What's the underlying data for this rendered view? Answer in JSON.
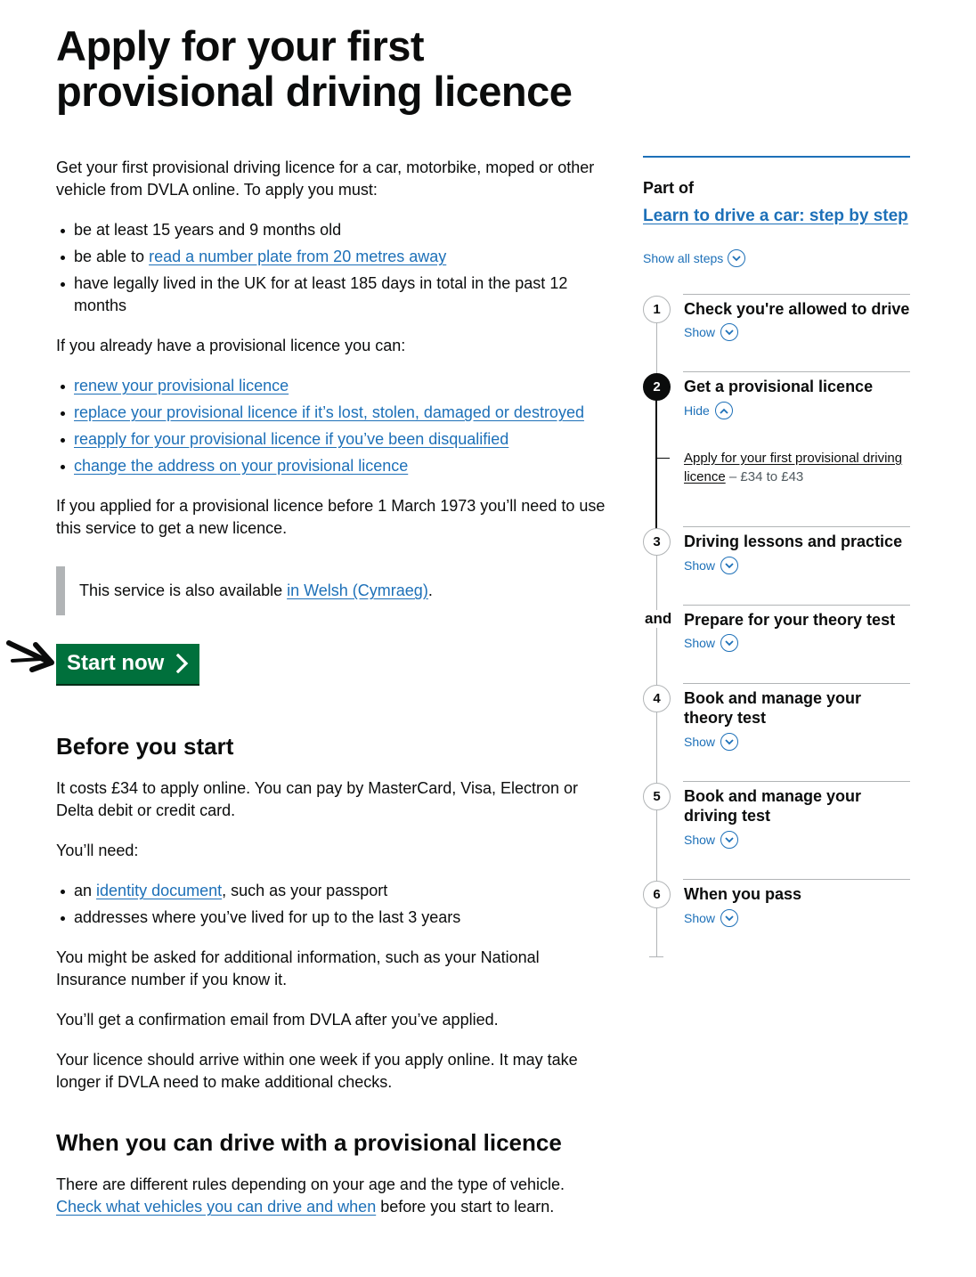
{
  "page": {
    "title": "Apply for your first provisional driving licence"
  },
  "main": {
    "intro": "Get your first provisional driving licence for a car, motorbike, moped or other vehicle from DVLA online. To apply you must:",
    "requirements": {
      "item1": "be at least 15 years and 9 months old",
      "item2_prefix": "be able to ",
      "item2_link": "read a number plate from 20 metres away",
      "item3": "have legally lived in the UK for at least 185 days in total in the past 12 months"
    },
    "already_have": "If you already have a provisional licence you can:",
    "links": [
      "renew your provisional licence",
      "replace your provisional licence if it’s lost, stolen, damaged or destroyed",
      "reapply for your provisional licence if you’ve been disqualified",
      "change the address on your provisional licence"
    ],
    "before_1973": "If you applied for a provisional licence before 1 March 1973 you’ll need to use this service to get a new licence.",
    "welsh": {
      "prefix": "This service is also available ",
      "link": "in Welsh (Cymraeg)",
      "suffix": "."
    },
    "start_button": "Start now",
    "before_you_start": {
      "heading": "Before you start",
      "costs": "It costs £34 to apply online. You can pay by MasterCard, Visa, Electron or Delta debit or credit card.",
      "need": "You’ll need:",
      "need_item1_prefix": "an ",
      "need_item1_link": "identity document",
      "need_item1_suffix": ", such as your passport",
      "need_item2": "addresses where you’ve lived for up to the last 3 years",
      "additional": "You might be asked for additional information, such as your National Insurance number if you know it.",
      "confirmation": "You’ll get a confirmation email from DVLA after you’ve applied.",
      "arrive": "Your licence should arrive within one week if you apply online. It may take longer if DVLA need to make additional checks."
    },
    "when_drive": {
      "heading": "When you can drive with a provisional licence",
      "text": "There are different rules depending on your age and the type of vehicle.",
      "link": "Check what vehicles you can drive and when",
      "suffix": " before you start to learn."
    }
  },
  "sidebar": {
    "part_of": "Part of",
    "link": "Learn to drive a car: step by step",
    "show_all": "Show all steps",
    "steps": [
      {
        "number": "1",
        "title": "Check you're allowed to drive",
        "toggle": "Show"
      },
      {
        "number": "2",
        "title": "Get a provisional licence",
        "toggle": "Hide",
        "sub_link": "Apply for your first provisional driving licence",
        "sub_price": " – £34 to £43"
      },
      {
        "number": "3",
        "title": "Driving lessons and practice",
        "toggle": "Show"
      },
      {
        "number": "and",
        "title": "Prepare for your theory test",
        "toggle": "Show"
      },
      {
        "number": "4",
        "title": "Book and manage your theory test",
        "toggle": "Show"
      },
      {
        "number": "5",
        "title": "Book and manage your driving test",
        "toggle": "Show"
      },
      {
        "number": "6",
        "title": "When you pass",
        "toggle": "Show"
      }
    ]
  },
  "colors": {
    "link": "#1d70b8",
    "start_button": "#00703c",
    "text": "#0b0c0c",
    "border": "#b1b4b6"
  }
}
